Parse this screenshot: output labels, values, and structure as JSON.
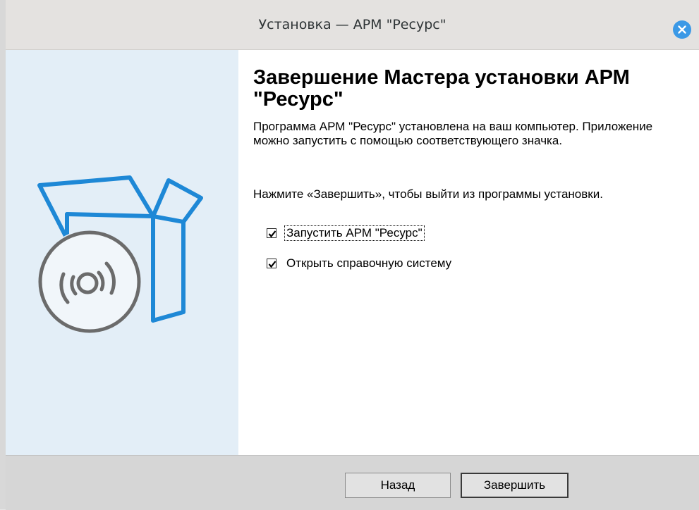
{
  "window": {
    "title": "Установка — АРМ \"Ресурс\""
  },
  "content": {
    "heading": "Завершение Мастера установки АРМ \"Ресурс\"",
    "description": "Программа АРМ \"Ресурс\" установлена на ваш компьютер. Приложение можно запустить с помощью соответствующего значка.",
    "instruction": "Нажмите «Завершить», чтобы выйти из программы установки.",
    "checkboxes": [
      {
        "label": "Запустить АРМ \"Ресурс\"",
        "checked": true
      },
      {
        "label": "Открыть справочную систему",
        "checked": true
      }
    ]
  },
  "footer": {
    "back_label": "Назад",
    "finish_label": "Завершить"
  },
  "colors": {
    "accent": "#3b99e6",
    "side_panel": "#e3eef7",
    "box_icon": "#1e88d6",
    "disc_icon": "#6b6b6b"
  },
  "icons": {
    "close": "close-icon",
    "installer": "installer-box-icon"
  }
}
